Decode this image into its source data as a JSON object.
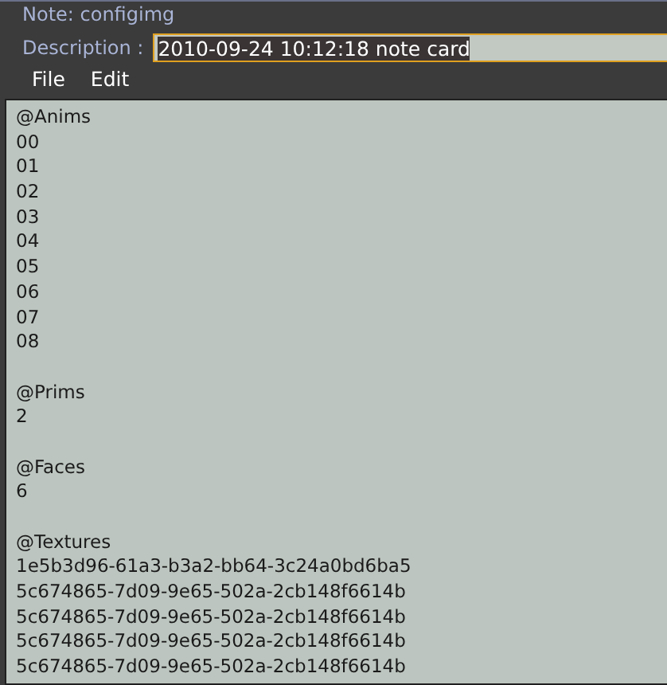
{
  "window": {
    "title": "Note: configimg"
  },
  "description": {
    "label": "Description :",
    "value": "2010-09-24 10:12:18 note card",
    "selected": true
  },
  "menu": [
    {
      "label": "File"
    },
    {
      "label": "Edit"
    }
  ],
  "sections": [
    {
      "heading": "@Anims",
      "lines": [
        "00",
        "01",
        "02",
        "03",
        "04",
        "05",
        "06",
        "07",
        "08"
      ]
    },
    {
      "heading": "@Prims",
      "lines": [
        "2"
      ]
    },
    {
      "heading": "@Faces",
      "lines": [
        "6"
      ]
    },
    {
      "heading": "@Textures",
      "lines": [
        "1e5b3d96-61a3-b3a2-bb64-3c24a0bd6ba5",
        "5c674865-7d09-9e65-502a-2cb148f6614b",
        "5c674865-7d09-9e65-502a-2cb148f6614b",
        "5c674865-7d09-9e65-502a-2cb148f6614b",
        "5c674865-7d09-9e65-502a-2cb148f6614b"
      ]
    }
  ]
}
